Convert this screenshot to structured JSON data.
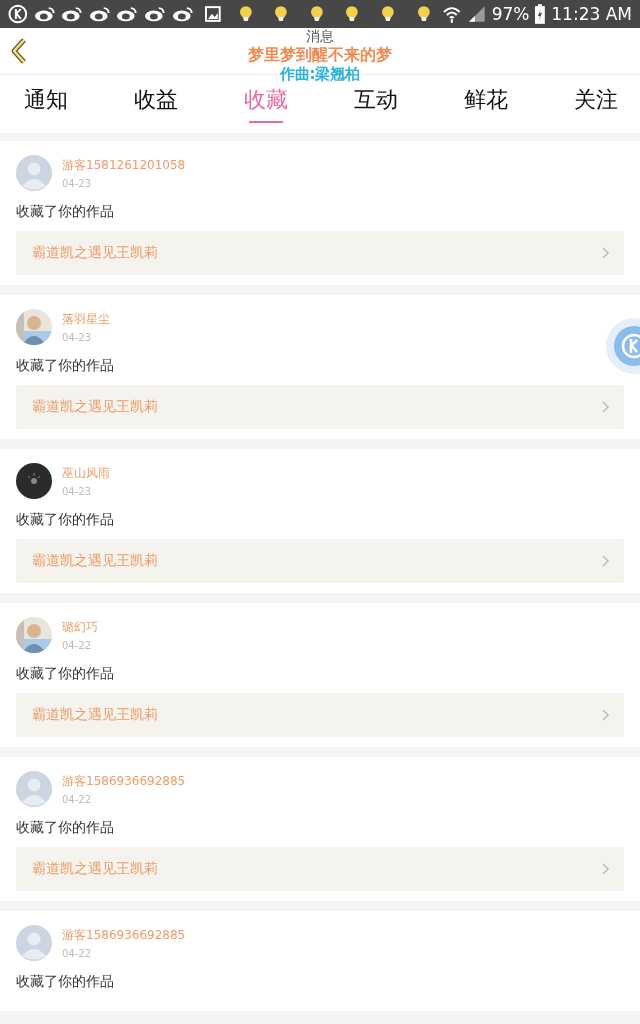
{
  "status_bar": {
    "battery_text": "97%",
    "time": "11:23 AM"
  },
  "header": {
    "title": "消息"
  },
  "lyrics_overlay": {
    "line": "梦里梦到醒不来的梦",
    "credit": "作曲:梁翘柏"
  },
  "tabs": [
    {
      "label": "通知",
      "selected": false
    },
    {
      "label": "收益",
      "selected": false
    },
    {
      "label": "收藏",
      "selected": true
    },
    {
      "label": "互动",
      "selected": false
    },
    {
      "label": "鲜花",
      "selected": false
    },
    {
      "label": "关注",
      "selected": false
    }
  ],
  "items": [
    {
      "avatar": {
        "kind": "default"
      },
      "name": "游客1581261201058",
      "date": "04-23",
      "action": "收藏了你的作品",
      "work": "霸道凯之遇见王凯莉"
    },
    {
      "name": "落羽星尘",
      "date": "04-23",
      "action": "收藏了你的作品",
      "work": "霸道凯之遇见王凯莉"
    },
    {
      "avatar": {
        "kind": "dark"
      },
      "name": "巫山风雨",
      "date": "04-23",
      "action": "收藏了你的作品",
      "work": "霸道凯之遇见王凯莉"
    },
    {
      "name": "璐幻巧",
      "date": "04-22",
      "action": "收藏了你的作品",
      "work": "霸道凯之遇见王凯莉"
    },
    {
      "avatar": {
        "kind": "default"
      },
      "name": "游客1586936692885",
      "date": "04-22",
      "action": "收藏了你的作品",
      "work": "霸道凯之遇见王凯莉"
    },
    {
      "avatar": {
        "kind": "default"
      },
      "name": "游客1586936692885",
      "date": "04-22",
      "action": "收藏了你的作品"
    }
  ]
}
